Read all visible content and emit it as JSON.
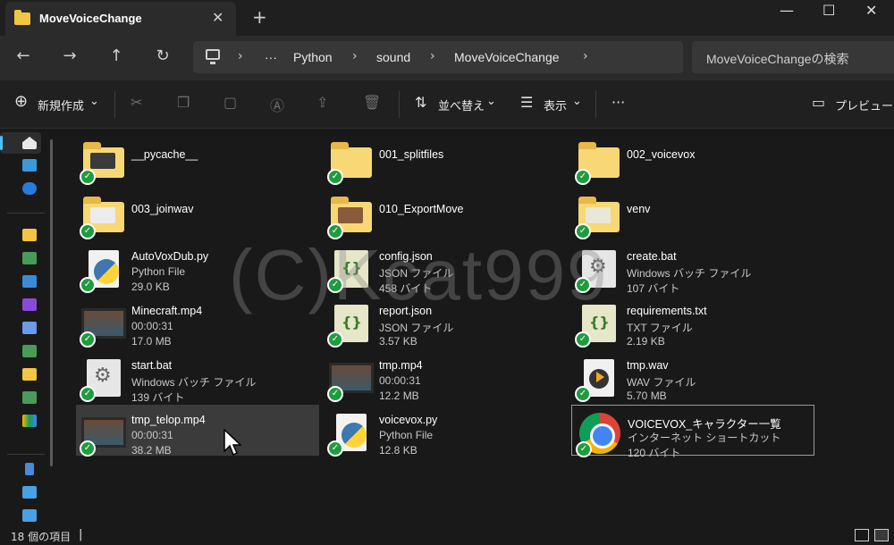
{
  "window": {
    "tab_title": "MoveVoiceChange",
    "tab_close": "✕",
    "new_tab": "+",
    "minimize": "—",
    "maximize": "☐",
    "close": "✕"
  },
  "nav": {
    "back": "←",
    "forward": "→",
    "up": "↑",
    "refresh": "↻",
    "more": "···",
    "sep": "›",
    "breadcrumb": [
      "Python",
      "sound",
      "MoveVoiceChange"
    ],
    "search_placeholder": "MoveVoiceChangeの検索"
  },
  "toolbar": {
    "new_label": "新規作成",
    "sort_label": "並べ替え",
    "view_label": "表示",
    "more": "···",
    "preview_label": "プレビュー",
    "chev": "⌄"
  },
  "items": [
    {
      "name": "__pycache__",
      "line2": "",
      "line3": "",
      "icon": "folder-icon"
    },
    {
      "name": "001_splitfiles",
      "line2": "",
      "line3": "",
      "icon": "folder-icon"
    },
    {
      "name": "002_voicevox",
      "line2": "",
      "line3": "",
      "icon": "folder-icon"
    },
    {
      "name": "003_joinwav",
      "line2": "",
      "line3": "",
      "icon": "folder-icon"
    },
    {
      "name": "010_ExportMove",
      "line2": "",
      "line3": "",
      "icon": "folder-icon"
    },
    {
      "name": "venv",
      "line2": "",
      "line3": "",
      "icon": "folder-icon"
    },
    {
      "name": "AutoVoxDub.py",
      "line2": "Python File",
      "line3": "29.0 KB",
      "icon": "python-file-icon"
    },
    {
      "name": "config.json",
      "line2": "JSON ファイル",
      "line3": "458 バイト",
      "icon": "json-file-icon"
    },
    {
      "name": "create.bat",
      "line2": "Windows バッチ ファイル",
      "line3": "107 バイト",
      "icon": "batch-file-icon"
    },
    {
      "name": "Minecraft.mp4",
      "line2": "00:00:31",
      "line3": "17.0 MB",
      "icon": "video-file-icon"
    },
    {
      "name": "report.json",
      "line2": "JSON ファイル",
      "line3": "3.57 KB",
      "icon": "json-file-icon"
    },
    {
      "name": "requirements.txt",
      "line2": "TXT ファイル",
      "line3": "2.19 KB",
      "icon": "text-file-icon"
    },
    {
      "name": "start.bat",
      "line2": "Windows バッチ ファイル",
      "line3": "139 バイト",
      "icon": "batch-file-icon"
    },
    {
      "name": "tmp.mp4",
      "line2": "00:00:31",
      "line3": "12.2 MB",
      "icon": "video-file-icon"
    },
    {
      "name": "tmp.wav",
      "line2": "WAV ファイル",
      "line3": "5.70 MB",
      "icon": "audio-file-icon"
    },
    {
      "name": "tmp_telop.mp4",
      "line2": "00:00:31",
      "line3": "38.2 MB",
      "icon": "video-file-icon"
    },
    {
      "name": "voicevox.py",
      "line2": "Python File",
      "line3": "12.8 KB",
      "icon": "python-file-icon"
    },
    {
      "name": "VOICEVOX_キャラクター一覧",
      "line2": "インターネット ショートカット",
      "line3": "120 バイト",
      "icon": "chrome-shortcut-icon"
    }
  ],
  "sync_check": "✓",
  "watermark": "(C)Kcat999",
  "status": {
    "count": "18 個の項目"
  }
}
